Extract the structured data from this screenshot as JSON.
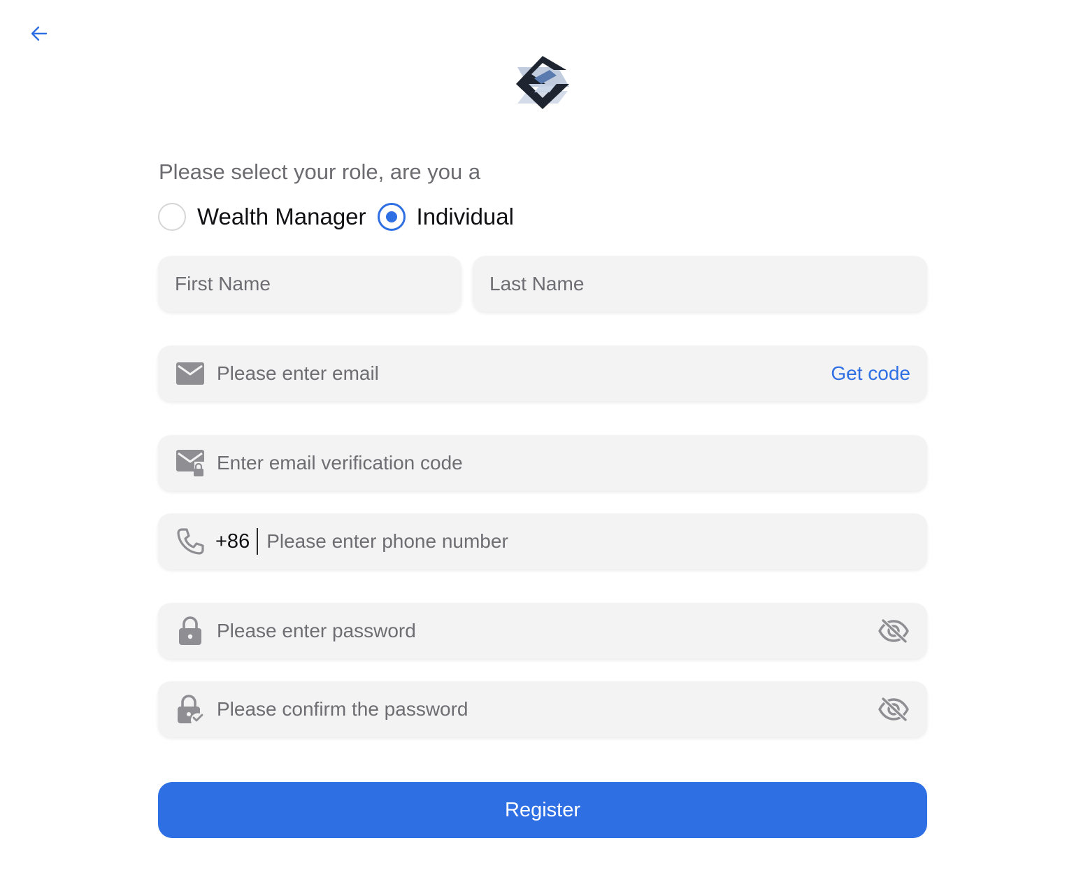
{
  "colors": {
    "accent": "#2f6fe4",
    "field_bg": "#f3f3f4",
    "icon_gray": "#8e8e93",
    "placeholder": "#6d6d72"
  },
  "nav": {
    "back_icon": "arrow-left-icon"
  },
  "logo": {
    "icon": "brand-logo"
  },
  "role": {
    "prompt": "Please select your role, are you a",
    "options": [
      {
        "label": "Wealth Manager",
        "checked": false
      },
      {
        "label": "Individual",
        "checked": true
      }
    ]
  },
  "form": {
    "first_name": {
      "placeholder": "First Name"
    },
    "last_name": {
      "placeholder": "Last Name"
    },
    "email": {
      "placeholder": "Please enter email",
      "icon": "mail-icon",
      "action_label": "Get code"
    },
    "email_code": {
      "placeholder": "Enter email verification code",
      "icon": "mail-lock-icon"
    },
    "phone": {
      "prefix": "+86",
      "placeholder": "Please enter phone number",
      "icon": "phone-icon"
    },
    "password": {
      "placeholder": "Please enter password",
      "icon": "lock-icon",
      "toggle_icon": "eye-off-icon"
    },
    "confirm_password": {
      "placeholder": "Please confirm the password",
      "icon": "lock-check-icon",
      "toggle_icon": "eye-off-icon"
    }
  },
  "submit": {
    "label": "Register"
  }
}
